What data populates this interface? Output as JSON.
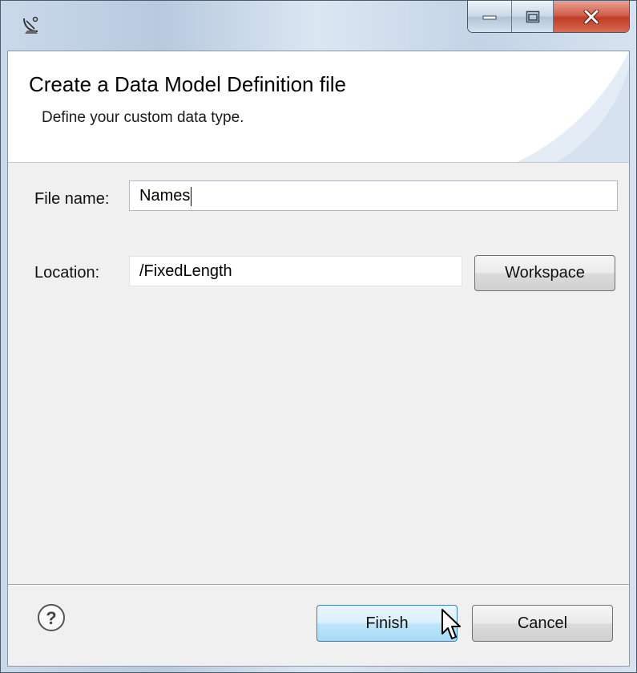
{
  "dialog": {
    "title": "Create a Data Model Definition file",
    "description": "Define your custom data type."
  },
  "form": {
    "file_name_label": "File name:",
    "file_name_value": "Names",
    "location_label": "Location:",
    "location_value": "/FixedLength",
    "workspace_button": "Workspace"
  },
  "footer": {
    "finish_button": "Finish",
    "cancel_button": "Cancel"
  },
  "icons": {
    "app": "satellite-dish-icon",
    "help": "help-icon",
    "minimize": "minimize-icon",
    "maximize": "maximize-icon",
    "close": "close-icon",
    "cursor": "mouse-pointer-icon"
  }
}
